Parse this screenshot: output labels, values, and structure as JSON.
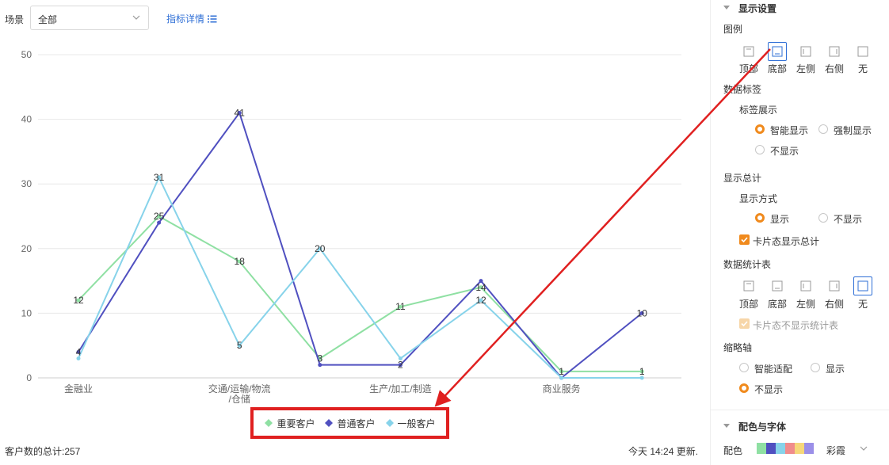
{
  "filter": {
    "label": "场景",
    "value": "全部",
    "detail_link": "指标详情"
  },
  "chart_data": {
    "type": "line",
    "categories": [
      "金融业",
      "",
      "交通/运输/物流/仓储",
      "",
      "生产/加工/制造",
      "",
      "商业服务",
      ""
    ],
    "category_lines": [
      [
        "金融业"
      ],
      [],
      [
        "交通/运输/物流",
        "/仓储"
      ],
      [],
      [
        "生产/加工/制造"
      ],
      [],
      [
        "商业服务"
      ],
      []
    ],
    "ylim": [
      0,
      50
    ],
    "yticks": [
      "0",
      "10",
      "20",
      "30",
      "40",
      "50"
    ],
    "series": [
      {
        "name": "重要客户",
        "color": "#8fe0a3",
        "values": [
          12,
          25,
          18,
          3,
          11,
          14,
          1,
          1
        ]
      },
      {
        "name": "普通客户",
        "color": "#5050c0",
        "values": [
          4,
          24,
          41,
          2,
          2,
          15,
          0,
          10
        ]
      },
      {
        "name": "一般客户",
        "color": "#87d3ea",
        "values": [
          3,
          31,
          5,
          20,
          3,
          12,
          0,
          0
        ]
      }
    ],
    "data_labels": [
      {
        "series": 0,
        "index": 0,
        "text": "12"
      },
      {
        "series": 0,
        "index": 1,
        "text": "25"
      },
      {
        "series": 0,
        "index": 2,
        "text": "18"
      },
      {
        "series": 0,
        "index": 3,
        "text": "3"
      },
      {
        "series": 0,
        "index": 4,
        "text": "11"
      },
      {
        "series": 0,
        "index": 5,
        "text": "14"
      },
      {
        "series": 0,
        "index": 6,
        "text": "1"
      },
      {
        "series": 0,
        "index": 7,
        "text": "1"
      },
      {
        "series": 1,
        "index": 0,
        "text": "4"
      },
      {
        "series": 1,
        "index": 2,
        "text": "41"
      },
      {
        "series": 1,
        "index": 4,
        "text": "2"
      },
      {
        "series": 1,
        "index": 7,
        "text": "10"
      },
      {
        "series": 2,
        "index": 1,
        "text": "31"
      },
      {
        "series": 2,
        "index": 2,
        "text": "5"
      },
      {
        "series": 2,
        "index": 3,
        "text": "20"
      },
      {
        "series": 2,
        "index": 5,
        "text": "12"
      }
    ],
    "legend": "bottom",
    "grid": true
  },
  "footer": {
    "total": "客户数的总计:257",
    "updated": "今天 14:24 更新."
  },
  "panel": {
    "display_settings": "显示设置",
    "legend_label": "图例",
    "positions": [
      "顶部",
      "底部",
      "左侧",
      "右侧",
      "无"
    ],
    "data_labels": "数据标签",
    "label_display": "标签展示",
    "smart_display": "智能显示",
    "force_display": "强制显示",
    "no_display": "不显示",
    "show_total": "显示总计",
    "display_mode": "显示方式",
    "show": "显示",
    "hide": "不显示",
    "card_total": "卡片态显示总计",
    "stats_table": "数据统计表",
    "card_no_stats": "卡片态不显示统计表",
    "thumb_axis": "缩略轴",
    "smart_fit": "智能适配",
    "axis_show": "显示",
    "axis_hide": "不显示",
    "color_font": "配色与字体",
    "color_label": "配色",
    "palette_name": "彩霞",
    "palette_colors": [
      "#8fe0a3",
      "#5050c0",
      "#87d3ea",
      "#f08c8c",
      "#f6d77a",
      "#9b8fe8"
    ]
  }
}
